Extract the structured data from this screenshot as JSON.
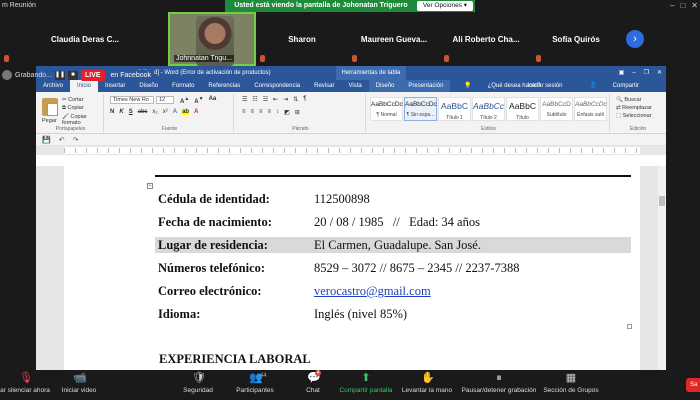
{
  "zoom": {
    "window_title": "m Reunión",
    "share_banner": "Usted está viendo la pantalla de Johonatan Triguero",
    "view_options": "Ver Opciones ▾",
    "participants": [
      {
        "name": "Claudia  Deras  C..."
      },
      {
        "name": "Johnnatan Trigu...",
        "video": true
      },
      {
        "name": "Sharon"
      },
      {
        "name": "Maureen  Gueva..."
      },
      {
        "name": "Ali  Roberto  Cha..."
      },
      {
        "name": "Sofía Quirós"
      }
    ],
    "next_icon": "chevron-right-icon",
    "recording_label": "Grabando...",
    "live_label": "LIVE",
    "live_target": "en Facebook",
    "toolbar": {
      "mute": "ar silenciar ahora",
      "video": "Iniciar video",
      "security": "Seguridad",
      "participants": "Participantes",
      "participants_count": "44",
      "chat": "Chat",
      "chat_badge": "4",
      "share": "Compartir pantalla",
      "raise_hand": "Levantar la mano",
      "pause_record": "Pausar/detener grabación",
      "rooms": "Sección de Grupos",
      "end": "Sa"
    }
  },
  "word": {
    "title": "...calibilidad] - Word (Error de activación de productos)",
    "context_title": "Herramientas de tabla",
    "tabs": [
      "Archivo",
      "Inicio",
      "Insertar",
      "Diseño",
      "Formato",
      "Referencias",
      "Correspondencia",
      "Revisar",
      "Vista",
      "Diseño",
      "Presentación"
    ],
    "active_tab": "Inicio",
    "tell_me": "¿Qué desea hacer?",
    "sign_in": "Iniciar sesión",
    "share": "Compartir",
    "ribbon": {
      "paste": "Pegar",
      "cut": "Cortar",
      "copy": "Copiar",
      "format_painter": "Copiar formato",
      "clipboard_group": "Portapapeles",
      "font_name": "Times New Ro",
      "font_size": "12",
      "font_group": "Fuente",
      "paragraph_group": "Párrafo",
      "styles_group": "Estilos",
      "editing_group": "Edición",
      "find": "Buscar",
      "replace": "Reemplazar",
      "select": "Seleccionar",
      "styles": [
        {
          "sample": "AaBbCcDc",
          "name": "¶ Normal"
        },
        {
          "sample": "AaBbCcDc",
          "name": "¶ Sin espa...",
          "selected": true
        },
        {
          "sample": "AaBbC",
          "name": "Título 1",
          "big": true
        },
        {
          "sample": "AaBbCc",
          "name": "Título 2",
          "big": true
        },
        {
          "sample": "AaBbC",
          "name": "Título",
          "big": true
        },
        {
          "sample": "AaBbCcD",
          "name": "Subtítulo"
        },
        {
          "sample": "AaBbCcDc",
          "name": "Énfasis sutil"
        }
      ]
    },
    "document": {
      "rows": [
        {
          "label": "Cédula de identidad:",
          "value": "112500898"
        },
        {
          "label": "Fecha de nacimiento:",
          "value": "20 / 08 / 1985   //   Edad: 34 años"
        },
        {
          "label": "Lugar de residencia:",
          "value": "El Carmen, Guadalupe. San José.",
          "highlight": true
        },
        {
          "label": "Números telefónico:",
          "value": "8529 – 3072 // 8675 – 2345 // 2237-7388"
        },
        {
          "label": "Correo electrónico:",
          "value": "verocastro@gmail.com",
          "link": true
        },
        {
          "label": "Idioma:",
          "value": "Inglés (nivel 85%)"
        }
      ],
      "section_heading": "EXPERIENCIA LABORAL"
    }
  }
}
